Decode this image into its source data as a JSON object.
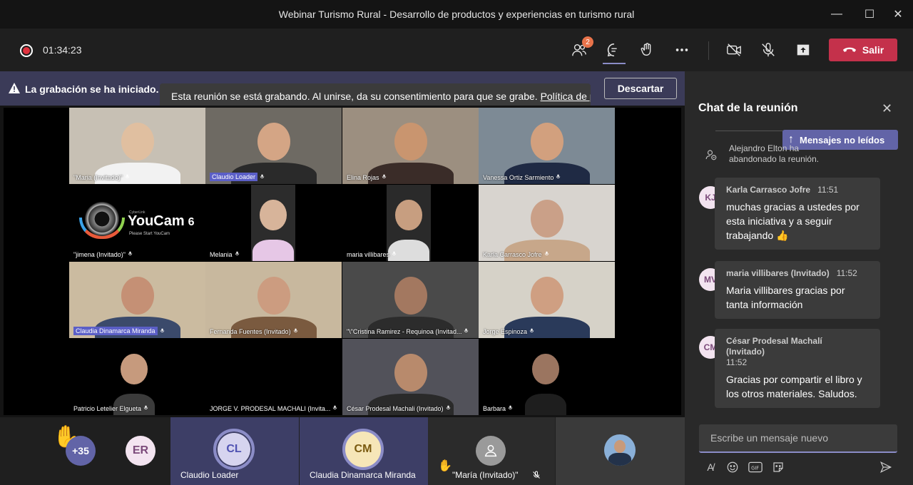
{
  "window": {
    "title": "Webinar Turismo Rural - Desarrollo de productos y experiencias en turismo rural",
    "min_glyph": "—",
    "max_glyph": "☐",
    "close_glyph": "✕"
  },
  "toolbar": {
    "elapsed": "01:34:23",
    "participants_badge": "2",
    "leave_label": "Salir"
  },
  "banner": {
    "title": "La grabación se ha iniciado.",
    "message": "Esta reunión se está grabando. Al unirse, da su consentimiento para que se grabe.",
    "policy_link": "Política de pri...",
    "dismiss_label": "Descartar"
  },
  "videos": [
    {
      "name": "\"Maria (Invitado)\""
    },
    {
      "name": "Claudio Loader"
    },
    {
      "name": "Elina Rojas"
    },
    {
      "name": "Vanessa Ortiz Sarmiento"
    },
    {
      "name": "\"jimena (Invitado)\""
    },
    {
      "name": "Melania"
    },
    {
      "name": "maria villibares"
    },
    {
      "name": "Karla Carrasco Jofre"
    },
    {
      "name": "Claudia Dinamarca Miranda"
    },
    {
      "name": "Fernanda Fuentes (Invitado)"
    },
    {
      "name": "\"\\\"Cristina Ramirez - Requinoa (Invitad..."
    },
    {
      "name": "Jorge  Espinoza"
    },
    {
      "name": "Patricio Letelier Elgueta"
    },
    {
      "name": "JORGE V. PRODESAL MACHALI (Invita..."
    },
    {
      "name": "César Prodesal Machali (Invitado)"
    },
    {
      "name": "Barbara"
    }
  ],
  "youcam": {
    "brand": "YouCam",
    "version": "6",
    "maker": "CyberLink",
    "hint": "Please Start YouCam"
  },
  "strip": {
    "overflow_count": "+35",
    "participants": [
      {
        "initials": "ER"
      },
      {
        "initials": "CL",
        "name": "Claudio Loader"
      },
      {
        "initials": "CM",
        "name": "Claudia Dinamarca Miranda"
      },
      {
        "name": "\"María (Invitado)\""
      }
    ]
  },
  "chat": {
    "title": "Chat de la reunión",
    "unread_label": "Mensajes no leídos",
    "system_message": "Alejandro Elton ha abandonado la reunión.",
    "messages": [
      {
        "initials": "KJ",
        "author": "Karla Carrasco Jofre",
        "time": "11:51",
        "text": "muchas gracias a ustedes por esta iniciativa y a seguir trabajando 👍"
      },
      {
        "initials": "MV",
        "author": "maria villibares (Invitado)",
        "time": "11:52",
        "text": "Maria villibares gracias por tanta información"
      },
      {
        "initials": "CM",
        "author": "César Prodesal Machalí (Invitado)",
        "time": "11:52",
        "text": "Gracias por compartir el libro y los otros materiales. Saludos."
      }
    ],
    "compose_placeholder": "Escribe un mensaje nuevo"
  },
  "colors": {
    "accent": "#6264a7",
    "leave": "#c4314b",
    "recording": "#e0333f",
    "banner": "#3b3b58"
  }
}
